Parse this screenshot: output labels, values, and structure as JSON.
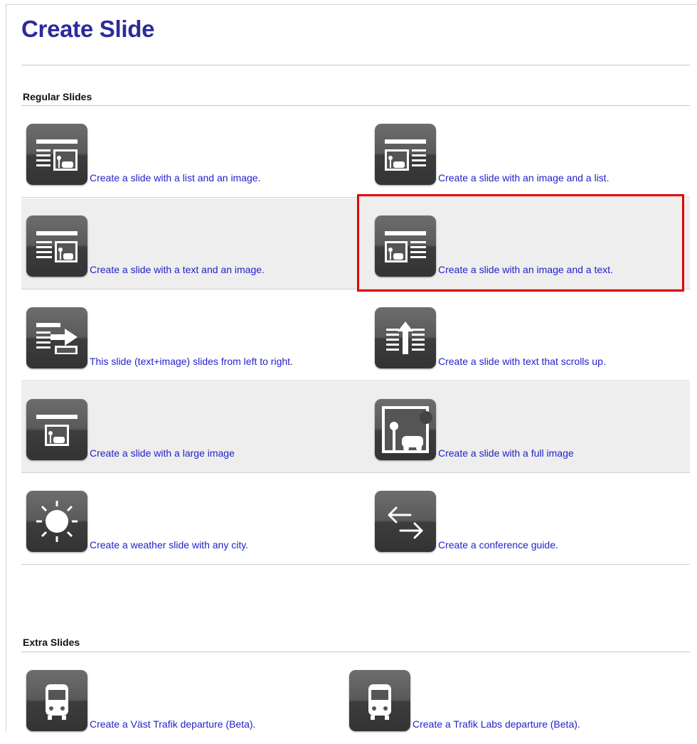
{
  "page": {
    "title": "Create Slide"
  },
  "sections": [
    {
      "title": "Regular Slides"
    },
    {
      "title": "Extra Slides"
    }
  ],
  "regular_rows": [
    {
      "left": {
        "icon": "list-image-icon",
        "label": "Create a slide with a list and an image."
      },
      "right": {
        "icon": "image-list-icon",
        "label": "Create a slide with an image and a list."
      }
    },
    {
      "left": {
        "icon": "text-image-icon",
        "label": "Create a slide with a text and an image."
      },
      "right": {
        "icon": "image-text-icon",
        "label": "Create a slide with an image and a text."
      }
    },
    {
      "left": {
        "icon": "slide-left-right-icon",
        "label": "This slide (text+image) slides from left to right."
      },
      "right": {
        "icon": "scroll-up-icon",
        "label": "Create a slide with text that scrolls up."
      }
    },
    {
      "left": {
        "icon": "large-image-icon",
        "label": "Create a slide with a large image"
      },
      "right": {
        "icon": "full-image-icon",
        "label": "Create a slide with a full image"
      }
    },
    {
      "left": {
        "icon": "weather-sun-icon",
        "label": "Create a weather slide with any city."
      },
      "right": {
        "icon": "conference-arrows-icon",
        "label": "Create a conference guide."
      }
    }
  ],
  "extra_rows": [
    {
      "left": {
        "icon": "bus-icon",
        "label": "Create a Väst Trafik departure (Beta)."
      },
      "right": {
        "icon": "bus-icon",
        "label": "Create a Trafik Labs departure (Beta)."
      }
    }
  ],
  "colors": {
    "title": "#2b2b9c",
    "link": "#2222cc",
    "highlight": "#e00000",
    "shaded_row": "#eeeeee"
  }
}
